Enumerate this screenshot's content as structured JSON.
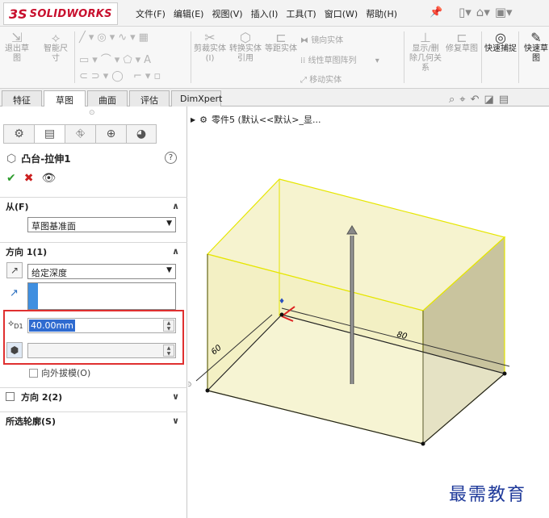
{
  "app": {
    "logo_ds": "3S",
    "logo_text": "SOLIDWORKS"
  },
  "menu": [
    "文件(F)",
    "编辑(E)",
    "视图(V)",
    "插入(I)",
    "工具(T)",
    "窗口(W)",
    "帮助(H)"
  ],
  "commands": {
    "exit_sketch": "退出草图",
    "smart_dim": "智能尺寸",
    "trim": "剪裁实体(I)",
    "convert": "转换实体引用",
    "offset": "等距实体",
    "mirror": "镜向实体",
    "linear_pattern": "线性草图阵列",
    "move": "移动实体",
    "show_hide": "显示/删除几何关系",
    "repair": "修复草图",
    "quick_snap": "快速捕捉",
    "quick_sketch": "快速草图"
  },
  "tabs": [
    "特征",
    "草图",
    "曲面",
    "评估",
    "DimXpert"
  ],
  "active_tab": "草图",
  "panel": {
    "title": "凸台-拉伸1",
    "help": "?",
    "from_label": "从(F)",
    "from_value": "草图基准面",
    "dir1_label": "方向 1(1)",
    "dir1_type": "给定深度",
    "depth_value": "40.00mm",
    "depth_icon_label": "D1",
    "draft_label": "向外拔模(O)",
    "dir2_label": "方向 2(2)",
    "contours_label": "所选轮廓(S)"
  },
  "tree": {
    "part_label": "零件5 (默认<<默认>_显..."
  },
  "dims": {
    "d1": "60",
    "d2": "80"
  },
  "watermark": "最需教育",
  "colors": {
    "extrude_fill": "#f3f0c4",
    "extrude_edge": "#e6e600",
    "highlight_box": "#e03030",
    "brand": "#c8102e"
  }
}
